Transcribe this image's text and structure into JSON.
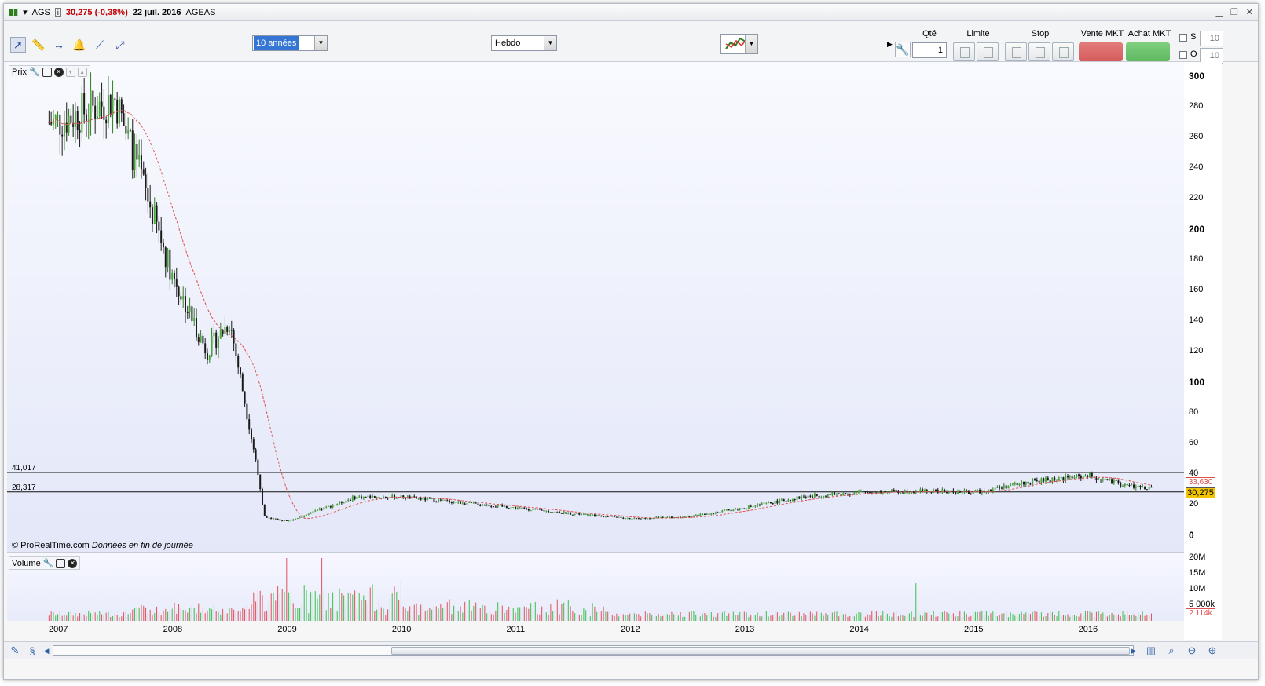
{
  "title": {
    "symbol": "AGS",
    "info_icon": "info-icon",
    "price_change": "30,275 (-0,38%)",
    "date": "22 juil. 2016",
    "name": "AGEAS"
  },
  "toolbar": {
    "period": "10 années",
    "timeframe": "Hebdo",
    "qty_label": "Qté",
    "qty_value": "1",
    "limit_label": "Limite",
    "stop_label": "Stop",
    "sell_label": "Vente MKT",
    "buy_label": "Achat MKT",
    "s_label": "S",
    "o_label": "O",
    "s_value": "10",
    "o_value": "10"
  },
  "price_pane": {
    "label": "Prix",
    "line1_label": "41,017",
    "line2_label": "28,317",
    "tag_ma": "33,630",
    "tag_last": "30,275",
    "copyright": "© ProRealTime.com",
    "data_note": "Données en fin de journée",
    "y_ticks": [
      "300",
      "280",
      "260",
      "240",
      "220",
      "200",
      "180",
      "160",
      "140",
      "120",
      "100",
      "80",
      "60",
      "40",
      "20",
      "0"
    ]
  },
  "volume_pane": {
    "label": "Volume",
    "y_ticks": [
      "20M",
      "15M",
      "10M",
      "5 000k"
    ],
    "tag_last": "2 114k"
  },
  "x_labels": [
    "2007",
    "2008",
    "2009",
    "2010",
    "2011",
    "2012",
    "2013",
    "2014",
    "2015",
    "2016"
  ],
  "colors": {
    "up": "#2e7d1e",
    "down": "#1a1a1a",
    "ma": "#e05050",
    "vol_up": "#3bbf4a",
    "vol_down": "#e0505a",
    "sell": "#e37b7b",
    "buy": "#7fcf7f"
  },
  "chart_data": {
    "type": "line",
    "series": [
      {
        "values_by_year": {
          "2007": 270,
          "2007.5": 285,
          "2008": 170,
          "2008.3": 120,
          "2008.5": 140,
          "2008.75": 40,
          "2008.8": 12,
          "2009": 9,
          "2009.6": 25,
          "2010": 25,
          "2011": 18,
          "2011.5": 14,
          "2012": 11,
          "2012.5": 12,
          "2013": 18,
          "2013.5": 25,
          "2014": 28,
          "2014.5": 29,
          "2015": 28,
          "2015.5": 35,
          "2016": 39,
          "2016.3": 33,
          "2016.55": 30.275
        }
      }
    ],
    "horizontal_lines": [
      41.017,
      28.317
    ],
    "ylim": [
      0,
      300
    ],
    "x": [
      "2007",
      "2008",
      "2009",
      "2010",
      "2011",
      "2012",
      "2013",
      "2014",
      "2015",
      "2016"
    ],
    "volume": {
      "ylim": [
        0,
        20000000
      ],
      "peak_values": {
        "2009": 20000000,
        "2009.3": 20000000,
        "2010": 13000000,
        "2014.5": 12000000
      }
    }
  }
}
